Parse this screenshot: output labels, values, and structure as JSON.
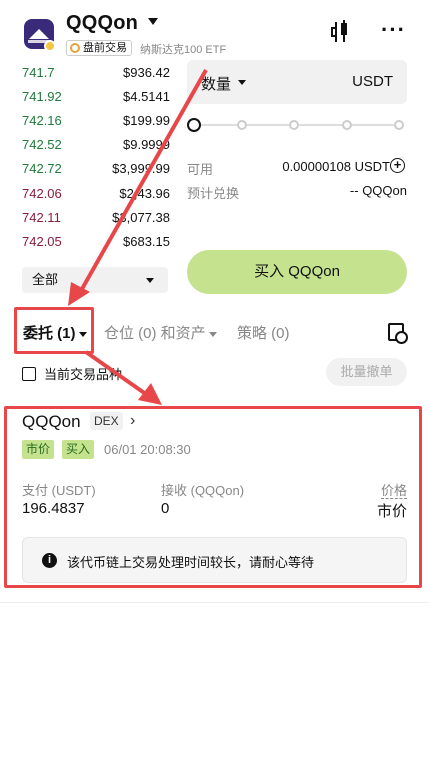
{
  "header": {
    "title": "QQQon",
    "tag": "盘前交易",
    "subtitle": "纳斯达克100 ETF"
  },
  "order_book": [
    {
      "price": "741.7",
      "amount": "$936.42",
      "side": "green"
    },
    {
      "price": "741.92",
      "amount": "$4.5141",
      "side": "green"
    },
    {
      "price": "742.16",
      "amount": "$199.99",
      "side": "green"
    },
    {
      "price": "742.52",
      "amount": "$9.9999",
      "side": "green"
    },
    {
      "price": "742.72",
      "amount": "$3,999.99",
      "side": "green"
    },
    {
      "price": "742.06",
      "amount": "$2,43.96",
      "side": "red"
    },
    {
      "price": "742.11",
      "amount": "$3,077.38",
      "side": "red"
    },
    {
      "price": "742.05",
      "amount": "$683.15",
      "side": "red"
    }
  ],
  "filter": {
    "label": "全部"
  },
  "trade": {
    "qty_label": "数量",
    "qty_unit": "USDT",
    "slider_level": 0,
    "avail_label": "可用",
    "avail_value": "0.00000108 USDT",
    "est_label": "预计兑换",
    "est_value": "-- QQQon",
    "buy_label": "买入 QQQon"
  },
  "tabs": {
    "orders": "委托 (1)",
    "positions": "仓位 (0) 和资产",
    "strategies": "策略 (0)"
  },
  "current_only": "当前交易品种",
  "bulk_cancel": "批量撤单",
  "order": {
    "name": "QQQon",
    "badge": "DEX",
    "type": "市价",
    "side": "买入",
    "time": "06/01 20:08:30",
    "pay_label": "支付 (USDT)",
    "pay_value": "196.4837",
    "receive_label": "接收 (QQQon)",
    "receive_value": "0",
    "price_label": "价格",
    "price_value": "市价",
    "notice": "该代币链上交易处理时间较长，请耐心等待"
  },
  "colors": {
    "accent_green": "#c5e38f",
    "bid": "#1f7a3a",
    "ask": "#8a1c3c",
    "annotation": "#e8474a"
  }
}
